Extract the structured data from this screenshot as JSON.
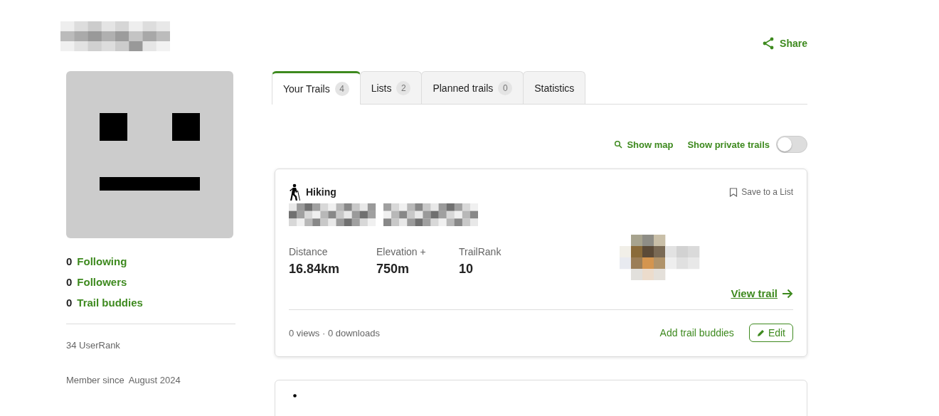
{
  "header": {
    "share": "Share"
  },
  "profile": {
    "stats": [
      {
        "count": "0",
        "label": "Following"
      },
      {
        "count": "0",
        "label": "Followers"
      },
      {
        "count": "0",
        "label": "Trail buddies"
      }
    ],
    "user_rank": "34 UserRank",
    "member_since_label": "Member since",
    "member_since": "August 2024"
  },
  "tabs": [
    {
      "label": "Your Trails",
      "count": "4",
      "selected": true
    },
    {
      "label": "Lists",
      "count": "2",
      "selected": false
    },
    {
      "label": "Planned trails",
      "count": "0",
      "selected": false
    },
    {
      "label": "Statistics",
      "selected": false
    }
  ],
  "toolbar": {
    "show_map": "Show map",
    "show_private": {
      "label": "Show private trails",
      "on": false
    }
  },
  "trails": [
    {
      "activity": "Hiking",
      "save": "Save to a List",
      "stats": [
        {
          "label": "Distance",
          "value": "16.84km"
        },
        {
          "label": "Elevation +",
          "value": "750m"
        },
        {
          "label": "TrailRank",
          "value": "10"
        }
      ],
      "view": "View trail",
      "footer": "0 views · 0 downloads",
      "add_buddies": "Add trail buddies",
      "edit": "Edit"
    }
  ]
}
